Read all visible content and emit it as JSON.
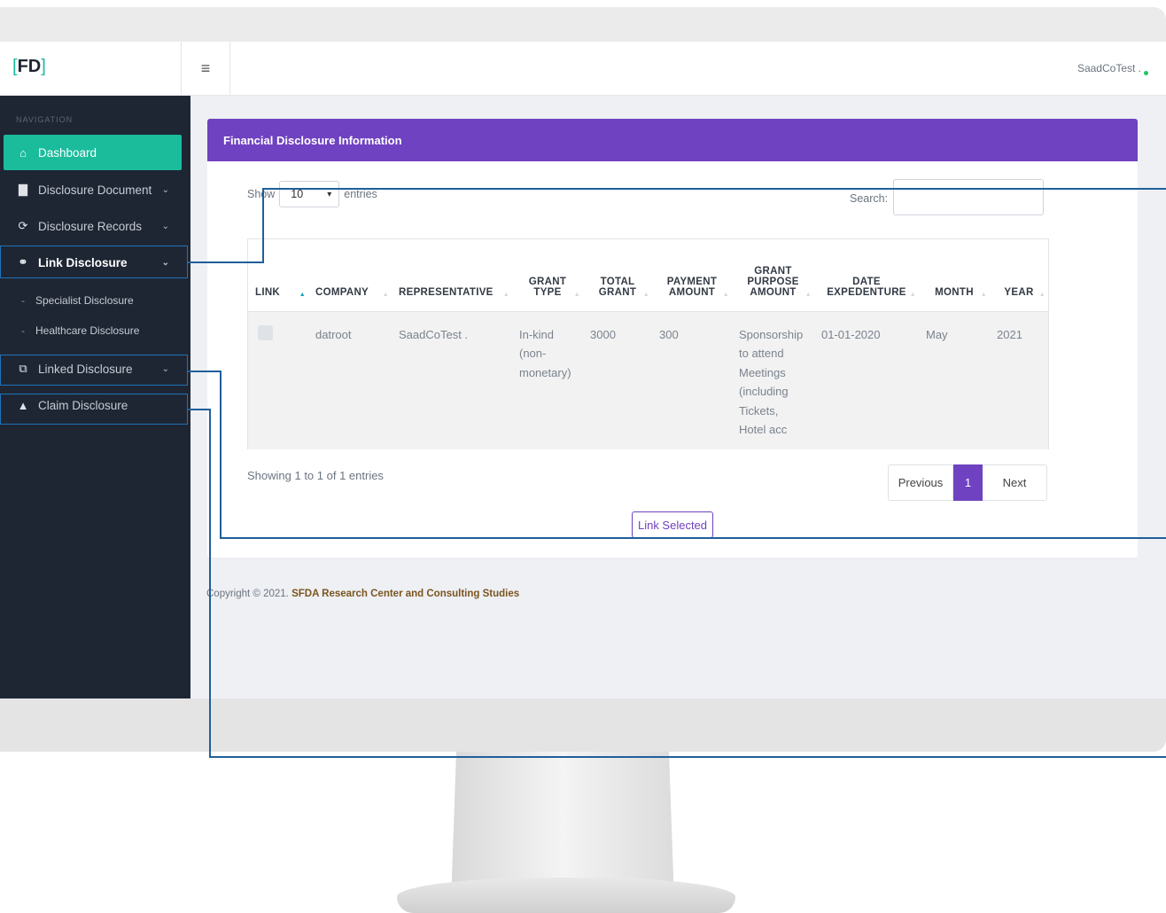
{
  "app": {
    "logo_text": "FD",
    "logo_left": "[",
    "logo_right": "]"
  },
  "header": {
    "menu_icon": "hamburger-icon",
    "user_name": "SaadCoTest .",
    "status_color": "#22c55e"
  },
  "sidebar": {
    "section_label": "NAVIGATION",
    "items": [
      {
        "label": "Dashboard",
        "icon": "home-icon"
      },
      {
        "label": "Disclosure Document",
        "icon": "document-icon"
      },
      {
        "label": "Disclosure Records",
        "icon": "refresh-icon"
      },
      {
        "label": "Link Disclosure",
        "icon": "link-icon"
      },
      {
        "label": "Linked Disclosure",
        "icon": "external-link-icon"
      },
      {
        "label": "Claim Disclosure",
        "icon": "warning-icon"
      }
    ],
    "sub_items": [
      {
        "label": "Specialist Disclosure"
      },
      {
        "label": "Healthcare Disclosure"
      }
    ]
  },
  "card": {
    "title": "Financial Disclosure Information",
    "show_label": "Show",
    "entries_label": "entries",
    "page_size": "10",
    "search_label": "Search:",
    "search_value": ""
  },
  "table": {
    "columns": [
      "LINK",
      "COMPANY",
      "REPRESENTATIVE",
      "GRANT TYPE",
      "TOTAL GRANT",
      "PAYMENT AMOUNT",
      "GRANT PURPOSE AMOUNT",
      "DATE EXPEDENTURE",
      "MONTH",
      "YEAR"
    ],
    "rows": [
      {
        "company": "datroot",
        "representative": "SaadCoTest .",
        "grant_type": "In-kind (non-monetary)",
        "total_grant": "3000",
        "payment_amount": "300",
        "grant_purpose": "Sponsorship to attend Meetings (including Tickets, Hotel acc",
        "date": "01-01-2020",
        "month": "May",
        "year": "2021"
      }
    ],
    "info": "Showing 1 to 1 of 1 entries"
  },
  "pagination": {
    "previous": "Previous",
    "current": "1",
    "next": "Next"
  },
  "actions": {
    "link_selected": "Link Selected"
  },
  "footer": {
    "text": "Copyright © 2021. ",
    "org": "SFDA Research Center and Consulting Studies"
  },
  "colors": {
    "accent": "#6f42c1",
    "teal": "#1abc9c",
    "sidebar": "#1e2634",
    "callout": "#1f5f9a"
  }
}
